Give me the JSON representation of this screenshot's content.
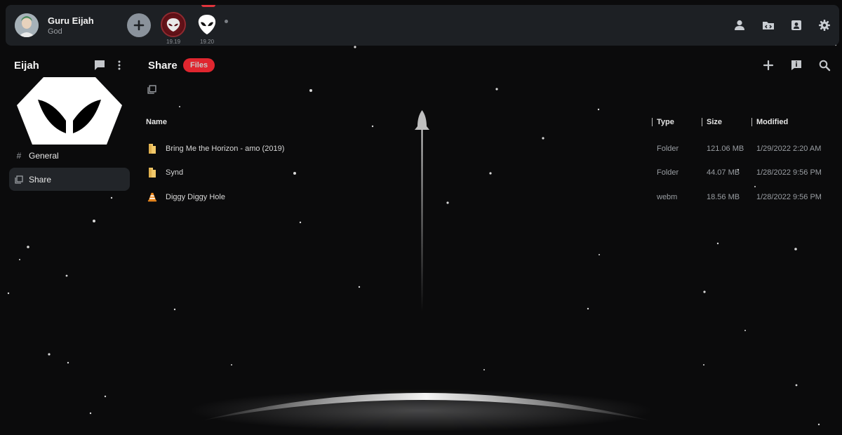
{
  "user": {
    "name": "Guru Eijah",
    "role": "God"
  },
  "servers": [
    {
      "name": "server-red-alien",
      "version": "19.19"
    },
    {
      "name": "server-white-alien",
      "version": "19.20"
    }
  ],
  "sidebar": {
    "title": "Eijah",
    "channels": [
      {
        "label": "General",
        "icon": "hash-icon",
        "active": false
      },
      {
        "label": "Share",
        "icon": "share-list-icon",
        "active": true
      }
    ]
  },
  "main": {
    "title": "Share",
    "badge": "Files",
    "columns": {
      "name": "Name",
      "type": "Type",
      "size": "Size",
      "modified": "Modified"
    },
    "rows": [
      {
        "name": "Bring Me the Horizon - amo (2019)",
        "icon": "folder-icon",
        "type": "Folder",
        "size": "121.06 MB",
        "modified": "1/29/2022  2:20 AM"
      },
      {
        "name": "Synd",
        "icon": "folder-icon",
        "type": "Folder",
        "size": "44.07 MB",
        "modified": "1/28/2022  9:56 PM"
      },
      {
        "name": "Diggy Diggy Hole",
        "icon": "vlc-cone-icon",
        "type": "webm",
        "size": "18.56 MB",
        "modified": "1/28/2022  9:56 PM"
      }
    ]
  },
  "colors": {
    "accent": "#e0262f",
    "panel": "#1d2024",
    "background": "#0b0b0c"
  }
}
